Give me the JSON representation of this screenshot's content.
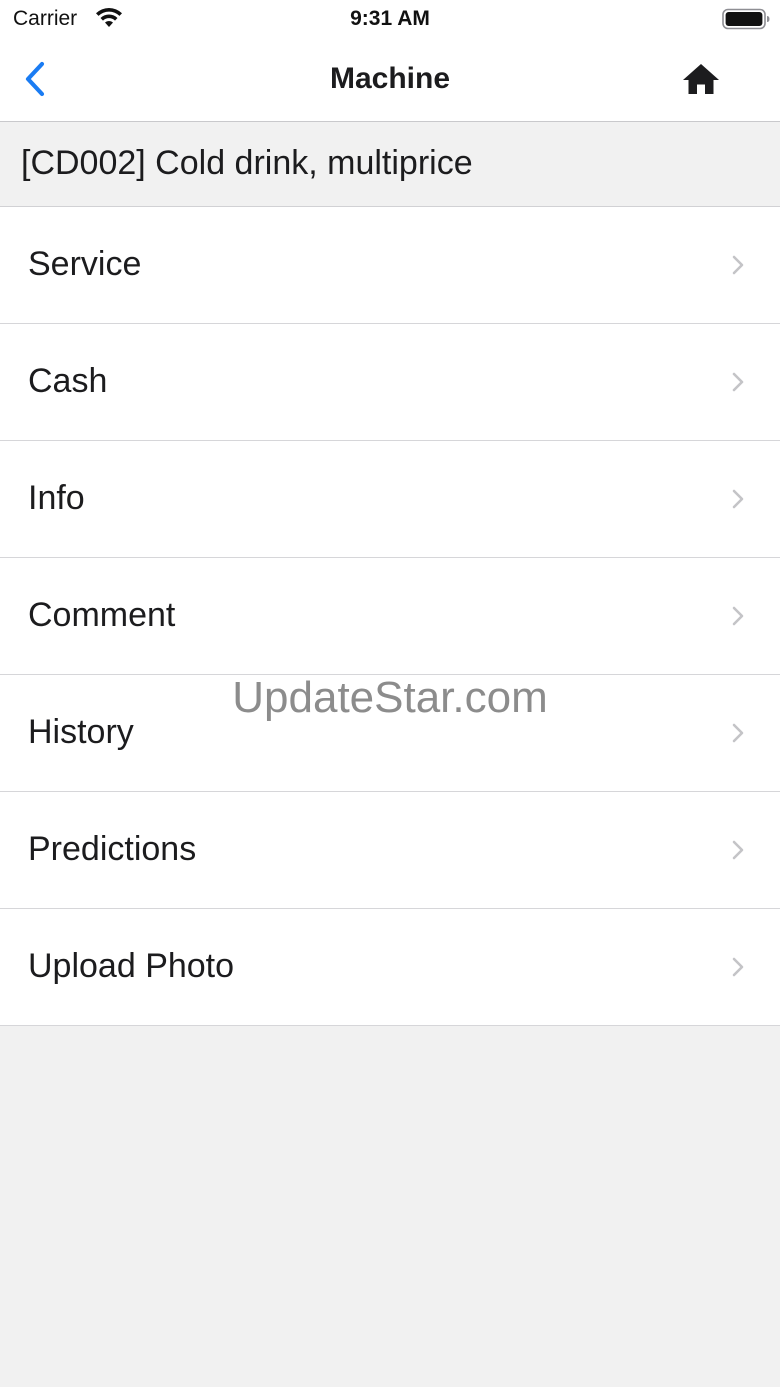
{
  "status_bar": {
    "carrier": "Carrier",
    "time": "9:31 AM",
    "wifi_icon": "wifi-icon",
    "battery_icon": "battery-icon"
  },
  "nav": {
    "title": "Machine",
    "back_icon": "chevron-left-icon",
    "home_icon": "home-icon",
    "accent_color": "#1a7cf3"
  },
  "machine": {
    "header": "[CD002] Cold drink, multiprice"
  },
  "menu": {
    "items": [
      {
        "label": "Service"
      },
      {
        "label": "Cash"
      },
      {
        "label": "Info"
      },
      {
        "label": "Comment"
      },
      {
        "label": "History"
      },
      {
        "label": "Predictions"
      },
      {
        "label": "Upload Photo"
      }
    ]
  },
  "watermark": {
    "text": "UpdateStar.com"
  },
  "colors": {
    "background": "#f1f1f1",
    "surface": "#ffffff",
    "separator": "#d6d6d9",
    "chevron": "#c4c4c7",
    "text": "#1c1c1e"
  }
}
